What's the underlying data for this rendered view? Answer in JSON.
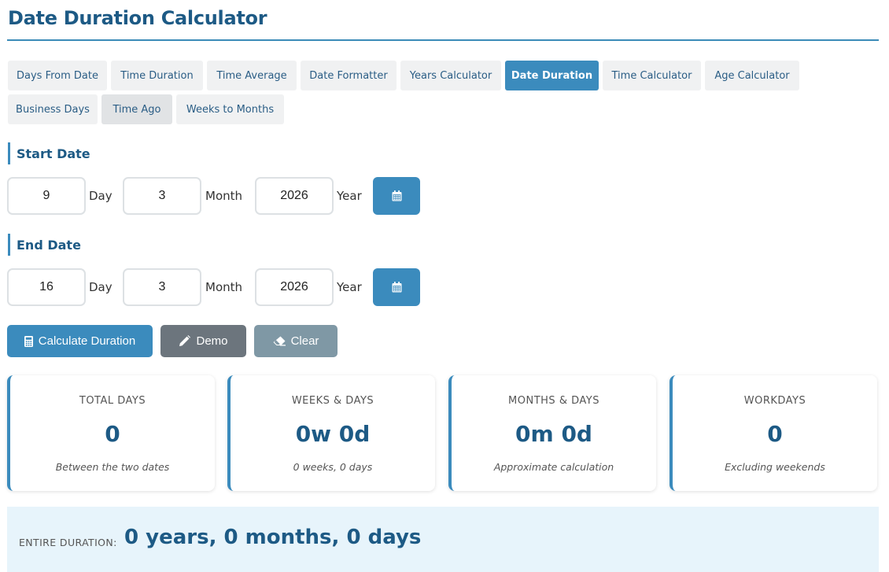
{
  "page": {
    "title": "Date Duration Calculator"
  },
  "tabs": [
    {
      "label": "Days From Date",
      "state": "normal"
    },
    {
      "label": "Time Duration",
      "state": "normal"
    },
    {
      "label": "Time Average",
      "state": "normal"
    },
    {
      "label": "Date Formatter",
      "state": "normal"
    },
    {
      "label": "Years Calculator",
      "state": "normal"
    },
    {
      "label": "Date Duration",
      "state": "active"
    },
    {
      "label": "Time Calculator",
      "state": "normal"
    },
    {
      "label": "Age Calculator",
      "state": "normal"
    },
    {
      "label": "Business Days",
      "state": "normal"
    },
    {
      "label": "Time Ago",
      "state": "hover"
    },
    {
      "label": "Weeks to Months",
      "state": "normal"
    }
  ],
  "start": {
    "label": "Start Date",
    "day": "9",
    "month": "3",
    "year": "2026",
    "day_unit": "Day",
    "month_unit": "Month",
    "year_unit": "Year"
  },
  "end": {
    "label": "End Date",
    "day": "16",
    "month": "3",
    "year": "2026",
    "day_unit": "Day",
    "month_unit": "Month",
    "year_unit": "Year"
  },
  "actions": {
    "calculate": "Calculate Duration",
    "demo": "Demo",
    "clear": "Clear"
  },
  "cards": [
    {
      "label": "TOTAL DAYS",
      "value": "0",
      "note": "Between the two dates"
    },
    {
      "label": "WEEKS & DAYS",
      "value": "0w 0d",
      "note": "0 weeks, 0 days"
    },
    {
      "label": "MONTHS & DAYS",
      "value": "0m 0d",
      "note": "Approximate calculation"
    },
    {
      "label": "WORKDAYS",
      "value": "0",
      "note": "Excluding weekends"
    }
  ],
  "entire": {
    "label": "ENTIRE DURATION:",
    "value": "0 years, 0 months, 0 days"
  },
  "icons": {
    "calendar": "calendar-icon",
    "calculator": "calculator-icon",
    "demo": "pencil-icon",
    "clear": "eraser-icon"
  },
  "colors": {
    "primary": "#3b8bbd",
    "heading": "#1d5a85",
    "demo": "#6c757d",
    "clear": "#7f98a5",
    "summary_bg": "#e7f4fb"
  }
}
